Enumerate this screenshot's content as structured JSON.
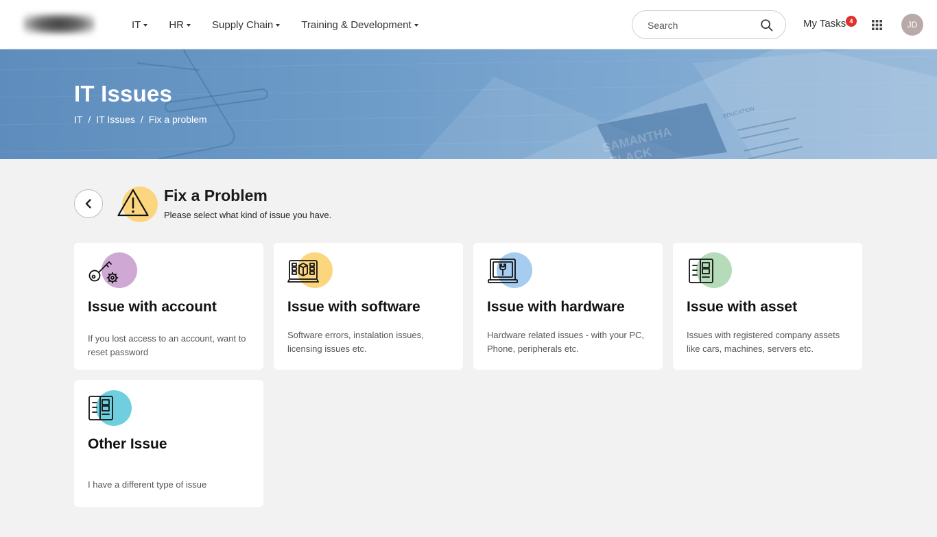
{
  "nav": {
    "items": [
      {
        "label": "IT"
      },
      {
        "label": "HR"
      },
      {
        "label": "Supply Chain"
      },
      {
        "label": "Training & Development"
      }
    ]
  },
  "search": {
    "placeholder": "Search"
  },
  "tasks": {
    "label": "My Tasks",
    "count": "4"
  },
  "user": {
    "initials": "JD"
  },
  "hero": {
    "title": "IT Issues",
    "breadcrumb": [
      "IT",
      "IT Issues",
      "Fix a problem"
    ],
    "separator": "/",
    "backdrop_text": {
      "name_1": "SAMANTHA",
      "name_2": "BLACK",
      "section": "EDUCATION"
    }
  },
  "header": {
    "title": "Fix a Problem",
    "subtitle": "Please select what kind of issue you have."
  },
  "cards": [
    {
      "title": "Issue with account",
      "description": "If you lost access to an account, want to reset password",
      "icon": "key-gear-icon",
      "accent": "#cfa9d3"
    },
    {
      "title": "Issue with software",
      "description": "Software errors, instalation issues, licensing issues etc.",
      "icon": "software-box-icon",
      "accent": "#fcd67e"
    },
    {
      "title": "Issue with hardware",
      "description": "Hardware related issues - with your PC, Phone, peripherals etc.",
      "icon": "laptop-wrench-icon",
      "accent": "#a6ccef"
    },
    {
      "title": "Issue with asset",
      "description": "Issues with registered company assets like cars, machines, servers etc.",
      "icon": "asset-list-icon",
      "accent": "#b5dbb8"
    },
    {
      "title": "Other Issue",
      "description": "I have a different type of issue",
      "icon": "other-list-icon",
      "accent": "#6fcfdf"
    }
  ],
  "colors": {
    "badge": "#e0302a",
    "hero": "#6b9ac7",
    "warning": "#fcd67e"
  }
}
